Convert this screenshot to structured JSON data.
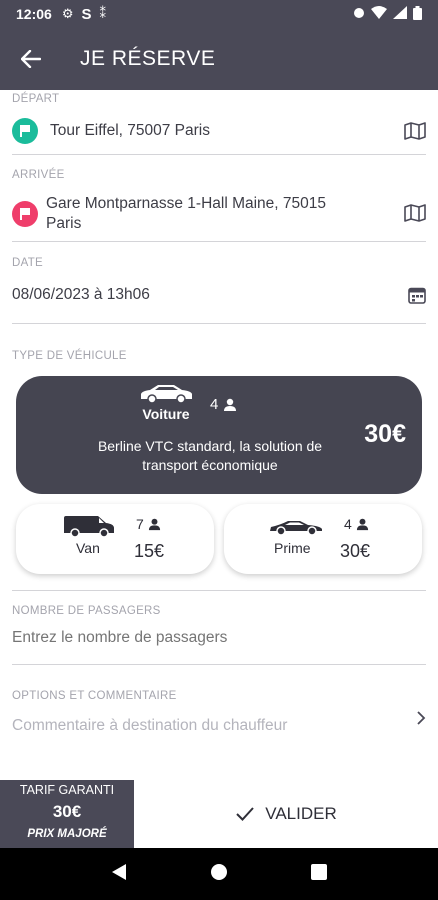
{
  "status_bar": {
    "time": "12:06"
  },
  "app_bar": {
    "title": "JE RÉSERVE"
  },
  "depart": {
    "label": "DÉPART",
    "value": "Tour Eiffel, 75007 Paris"
  },
  "arrivee": {
    "label": "ARRIVÉE",
    "value_line1": "Gare Montparnasse 1-Hall Maine, 75015",
    "value_line2": "Paris"
  },
  "date": {
    "label": "DATE",
    "value": "08/06/2023 à 13h06"
  },
  "vehicle": {
    "section_label": "TYPE DE VÉHICULE",
    "selected": {
      "name": "Voiture",
      "capacity": "4",
      "description_line1": "Berline VTC standard, la solution de",
      "description_line2": "transport économique",
      "price": "30€"
    },
    "options": [
      {
        "name": "Van",
        "capacity": "7",
        "price": "15€"
      },
      {
        "name": "Prime",
        "capacity": "4",
        "price": "30€"
      }
    ]
  },
  "passagers": {
    "label": "NOMBRE DE PASSAGERS",
    "placeholder": "Entrez le nombre de passagers"
  },
  "options": {
    "label": "OPTIONS ET COMMENTAIRE",
    "placeholder": "Commentaire à destination du chauffeur"
  },
  "tarif": {
    "title": "TARIF GARANTI",
    "price": "30€",
    "note": "PRIX MAJORÉ"
  },
  "valider": {
    "label": "VALIDER"
  },
  "colors": {
    "app_bar": "#4a4957",
    "depart_pin": "#1bbc9b",
    "arrivee_pin": "#ef3e6b",
    "card_dark": "#454551"
  }
}
